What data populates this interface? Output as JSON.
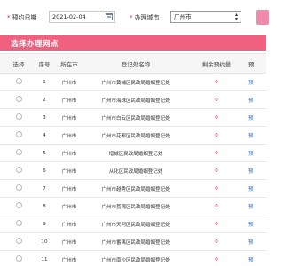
{
  "filters": {
    "date_label": "预约日期",
    "date_value": "2021-02-04",
    "city_label": "办理城市",
    "city_value": "广州市"
  },
  "section": {
    "title": "选择办理网点"
  },
  "table": {
    "headers": {
      "select": "选择",
      "index": "序号",
      "city": "所在市",
      "name": "登记处名称",
      "remaining": "剩余预约量",
      "action": "预"
    },
    "rows": [
      {
        "index": "1",
        "city": "广州市",
        "name": "广州市黄埔区民政局婚姻登记处",
        "remaining": "0",
        "action": "预"
      },
      {
        "index": "2",
        "city": "广州市",
        "name": "广州市海珠区民政局婚姻登记处",
        "remaining": "0",
        "action": "预"
      },
      {
        "index": "3",
        "city": "广州市",
        "name": "广州市白云区民政局婚姻登记处",
        "remaining": "0",
        "action": "预"
      },
      {
        "index": "4",
        "city": "广州市",
        "name": "广州市花都区民政局婚姻登记处",
        "remaining": "0",
        "action": "预"
      },
      {
        "index": "5",
        "city": "广州市",
        "name": "增城区民政局婚姻登记处",
        "remaining": "0",
        "action": "预"
      },
      {
        "index": "6",
        "city": "广州市",
        "name": "从化区民政局婚姻登记处",
        "remaining": "0",
        "action": "预"
      },
      {
        "index": "7",
        "city": "广州市",
        "name": "广州市越秀区民政局婚姻登记处",
        "remaining": "0",
        "action": "预"
      },
      {
        "index": "8",
        "city": "广州市",
        "name": "广州市荔湾区民政局婚姻登记处",
        "remaining": "0",
        "action": "预"
      },
      {
        "index": "9",
        "city": "广州市",
        "name": "广州市天河区民政局婚姻登记处",
        "remaining": "0",
        "action": "预"
      },
      {
        "index": "10",
        "city": "广州市",
        "name": "广州市番禺区民政局婚姻登记处",
        "remaining": "0",
        "action": "预"
      },
      {
        "index": "11",
        "city": "广州市",
        "name": "广州市南沙区民政局婚姻登记处",
        "remaining": "0",
        "action": "预"
      }
    ]
  },
  "colors": {
    "accent": "#f0607f",
    "required": "#e0241b",
    "link": "#2b6ed0"
  },
  "icons": {
    "date": "calendar-icon",
    "select": "dropdown-arrow-icon"
  }
}
